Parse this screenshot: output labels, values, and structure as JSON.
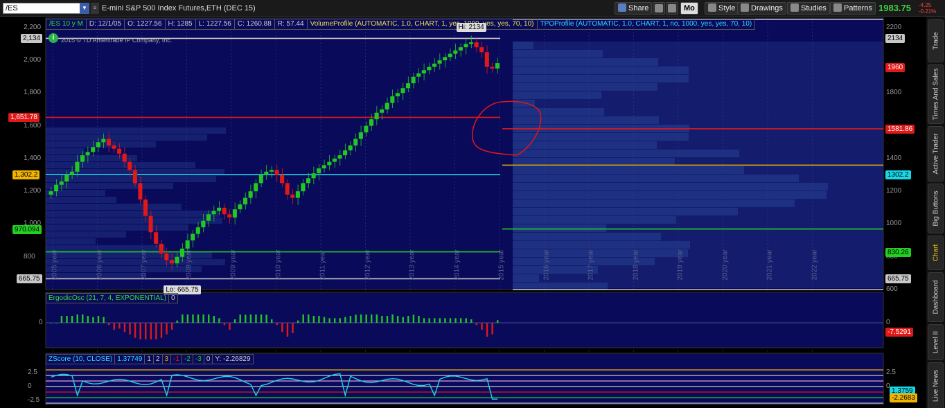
{
  "toolbar": {
    "symbol": "/ES",
    "instrument_title": "E-mini S&P 500 Index Futures,ETH (DEC 15)",
    "share_label": "Share",
    "mo_label": "Mo",
    "style_label": "Style",
    "drawings_label": "Drawings",
    "studies_label": "Studies",
    "patterns_label": "Patterns",
    "last_price": "1983.75",
    "change_top": "-4.25",
    "change_bottom": "-0.21%"
  },
  "study_header": {
    "timeframe": "/ES 10 y M",
    "date": "D: 12/1/05",
    "open": "O: 1227.56",
    "high": "H: 1285",
    "low": "L: 1227.56",
    "close": "C: 1260.88",
    "range": "R: 57.44",
    "volume_profile": "VolumeProfile (AUTOMATIC, 1.0, CHART, 1, yes, 1000, yes, yes, 70, 10)",
    "tpo_profile": "TPOProfile (AUTOMATIC, 1.0, CHART, 1, no, 1000, yes, yes, 70, 10)"
  },
  "copyright": "2015 © TD Ameritrade IP Company, Inc.",
  "info_icon": "i",
  "left_axis": {
    "ticks": [
      "2,200",
      "2,000",
      "1,800",
      "1,600",
      "1,400",
      "1,200",
      "1,000",
      "800"
    ],
    "tags": [
      {
        "text": "2,134",
        "color": "#c8c8c8",
        "text_color": "#000"
      },
      {
        "text": "1,651.78",
        "color": "#e01818",
        "text_color": "#fff"
      },
      {
        "text": "1,302.2",
        "color": "#f0b400",
        "text_color": "#000"
      },
      {
        "text": "970.094",
        "color": "#22d022",
        "text_color": "#000"
      },
      {
        "text": "665.75",
        "color": "#c8c8c8",
        "text_color": "#000"
      }
    ]
  },
  "right_axis": {
    "ticks": [
      "2200",
      "1800",
      "1400",
      "1200",
      "1000",
      "800",
      "600"
    ],
    "tags": [
      {
        "text": "2134",
        "color": "#c8c8c8",
        "text_color": "#000"
      },
      {
        "text": "1960",
        "color": "#e01818",
        "text_color": "#fff"
      },
      {
        "text": "1581.86",
        "color": "#e01818",
        "text_color": "#fff"
      },
      {
        "text": "1302.2",
        "color": "#18d8e8",
        "text_color": "#000"
      },
      {
        "text": "830.26",
        "color": "#22d022",
        "text_color": "#000"
      },
      {
        "text": "665.75",
        "color": "#c8c8c8",
        "text_color": "#000"
      }
    ]
  },
  "year_labels": [
    "2005 year",
    "2006 year",
    "2007 year",
    "2008 year",
    "2009 year",
    "2010 year",
    "2011 year",
    "2012 year",
    "2013 year",
    "2014 year",
    "2015 year",
    "2016 year",
    "2017 year",
    "2018 year",
    "2019 year",
    "2020 year",
    "2021 year",
    "2022 year"
  ],
  "hi_label": "Hi: 2134",
  "lo_label": "Lo: 665.75",
  "ergodic": {
    "title": "ErgodicOsc (21, 7, 4, EXPONENTIAL)",
    "value": "0",
    "zero_left": "0",
    "zero_right": "0",
    "tag": "-7.5291"
  },
  "zscore": {
    "title": "ZScore (10, CLOSE)",
    "value": "1.37749",
    "levels": [
      "1",
      "2",
      "3",
      "-1",
      "-2",
      "-3",
      "0"
    ],
    "y_readout": "Y: -2.26829",
    "left_ticks": [
      "2.5",
      "0",
      "-2.5"
    ],
    "right_ticks": [
      "2.5",
      "0"
    ],
    "tags": [
      {
        "text": "1.3759",
        "color": "#18d8e8",
        "text_color": "#000"
      },
      {
        "text": "-2.2683",
        "color": "#f0b400",
        "text_color": "#000"
      }
    ]
  },
  "side_tabs": [
    "Trade",
    "Times And Sales",
    "Active Trader",
    "Big Buttons",
    "Chart",
    "Dashboard",
    "Level II",
    "Live News"
  ],
  "colors": {
    "chart_bg": "#0a0a5a",
    "up_bar": "#22c822",
    "down_bar": "#e01818",
    "hi_lo_line": "#c8c8c8",
    "red_level": "#e01818",
    "cyan_level": "#18d8e8",
    "green_level": "#22d022",
    "orange_level": "#f0b400",
    "zscore_line": "#18d8e8"
  },
  "chart_data": {
    "type": "candlestick",
    "timeframe": "monthly",
    "x_range": [
      "2005",
      "2015"
    ],
    "ylim": [
      600,
      2250
    ],
    "series": [
      {
        "name": "/ES",
        "values": [
          1200,
          1240,
          1260,
          1300,
          1320,
          1380,
          1420,
          1440,
          1470,
          1500,
          1520,
          1480,
          1460,
          1430,
          1380,
          1330,
          1250,
          1150,
          1050,
          950,
          880,
          820,
          780,
          760,
          800,
          850,
          900,
          940,
          980,
          1020,
          1060,
          1080,
          1100,
          1060,
          1040,
          1090,
          1120,
          1160,
          1200,
          1250,
          1300,
          1320,
          1330,
          1300,
          1250,
          1180,
          1160,
          1200,
          1250,
          1280,
          1310,
          1340,
          1360,
          1380,
          1400,
          1420,
          1450,
          1480,
          1520,
          1560,
          1600,
          1640,
          1680,
          1700,
          1740,
          1780,
          1800,
          1830,
          1860,
          1900,
          1920,
          1940,
          1960,
          1980,
          2000,
          2020,
          2040,
          2060,
          2080,
          2100,
          2110,
          2080,
          2050,
          1960,
          1950,
          1983
        ]
      }
    ],
    "levels": [
      {
        "name": "Hi",
        "value": 2134
      },
      {
        "name": "Lo",
        "value": 665.75
      },
      {
        "value": 1651.78
      },
      {
        "value": 1302.2
      },
      {
        "value": 970.094
      }
    ]
  }
}
